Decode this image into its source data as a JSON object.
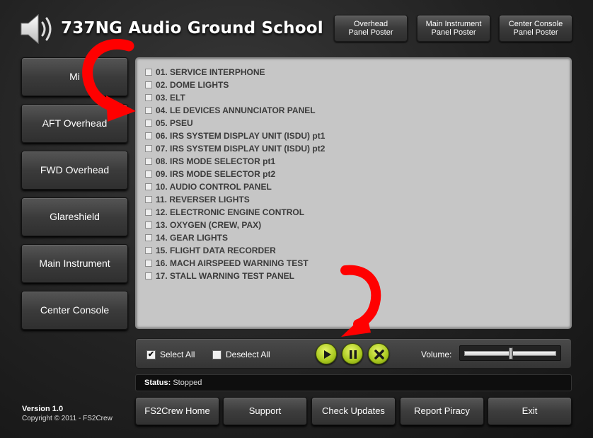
{
  "header": {
    "title": "737NG Audio Ground School",
    "posters": [
      {
        "line1": "Overhead",
        "line2": "Panel Poster"
      },
      {
        "line1": "Main Instrument",
        "line2": "Panel Poster"
      },
      {
        "line1": "Center Console",
        "line2": "Panel Poster"
      }
    ]
  },
  "sidebar": {
    "items": [
      {
        "label": "Mi"
      },
      {
        "label": "AFT Overhead"
      },
      {
        "label": "FWD Overhead"
      },
      {
        "label": "Glareshield"
      },
      {
        "label": "Main Instrument"
      },
      {
        "label": "Center Console"
      }
    ]
  },
  "tracks": [
    "01. SERVICE INTERPHONE",
    "02. DOME LIGHTS",
    "03. ELT",
    "04. LE DEVICES ANNUNCIATOR PANEL",
    "05. PSEU",
    "06. IRS SYSTEM DISPLAY UNIT (ISDU) pt1",
    "07. IRS SYSTEM DISPLAY UNIT (ISDU) pt2",
    "08. IRS MODE SELECTOR pt1",
    "09. IRS MODE SELECTOR pt2",
    "10. AUDIO CONTROL PANEL",
    "11. REVERSER LIGHTS",
    "12. ELECTRONIC ENGINE CONTROL",
    "13. OXYGEN (CREW, PAX)",
    "14. GEAR LIGHTS",
    "15. FLIGHT DATA RECORDER",
    "16. MACH AIRSPEED WARNING TEST",
    "17. STALL WARNING TEST PANEL"
  ],
  "controls": {
    "select_all": "Select All",
    "select_all_checked": true,
    "deselect_all": "Deselect All",
    "deselect_all_checked": false,
    "volume_label": "Volume:",
    "volume_level": 0.5,
    "icons": {
      "play": "play-icon",
      "pause": "pause-icon",
      "stop": "stop-icon"
    },
    "accent_color": "#a9c81e"
  },
  "status": {
    "label": "Status:",
    "value": "Stopped"
  },
  "footer": {
    "buttons": [
      "FS2Crew Home",
      "Support",
      "Check Updates",
      "Report Piracy",
      "Exit"
    ],
    "version": "Version 1.0",
    "copyright": "Copyright © 2011 - FS2Crew"
  },
  "annotations": {
    "arrow_color": "#ff0000"
  }
}
